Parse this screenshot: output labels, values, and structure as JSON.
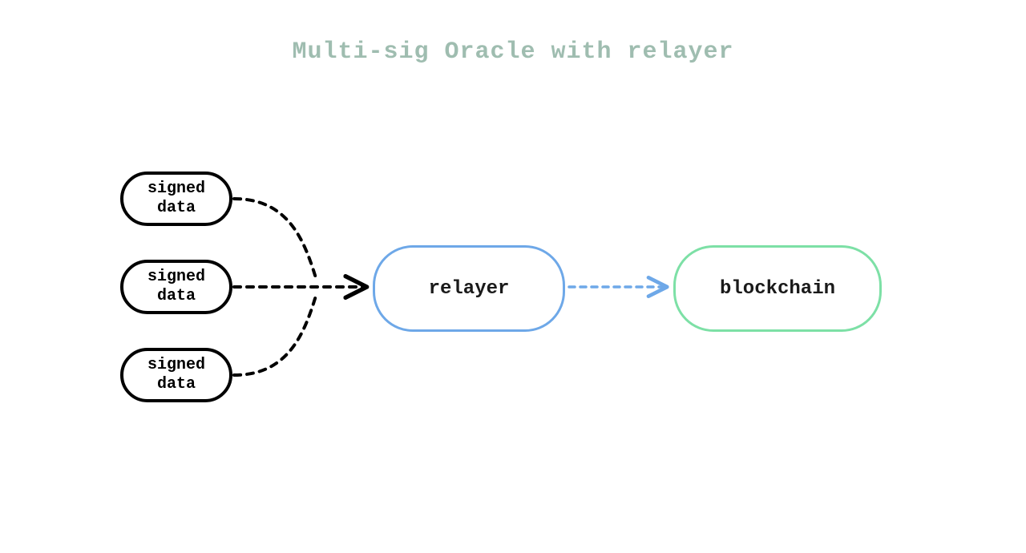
{
  "title": "Multi-sig Oracle with relayer",
  "nodes": {
    "signed1": {
      "line1": "signed",
      "line2": "data"
    },
    "signed2": {
      "line1": "signed",
      "line2": "data"
    },
    "signed3": {
      "line1": "signed",
      "line2": "data"
    },
    "relayer": {
      "label": "relayer"
    },
    "blockchain": {
      "label": "blockchain"
    }
  },
  "colors": {
    "title": "#9fbdb0",
    "signedBorder": "#000000",
    "relayerBorder": "#6ea8e8",
    "blockchainBorder": "#7de0a6",
    "arrowBlack": "#000000",
    "arrowBlue": "#6ea8e8"
  },
  "edges": [
    {
      "from": "signed1",
      "to": "relayer",
      "style": "dashed",
      "color": "black"
    },
    {
      "from": "signed2",
      "to": "relayer",
      "style": "dashed",
      "color": "black"
    },
    {
      "from": "signed3",
      "to": "relayer",
      "style": "dashed",
      "color": "black"
    },
    {
      "from": "relayer",
      "to": "blockchain",
      "style": "dashed",
      "color": "blue"
    }
  ]
}
